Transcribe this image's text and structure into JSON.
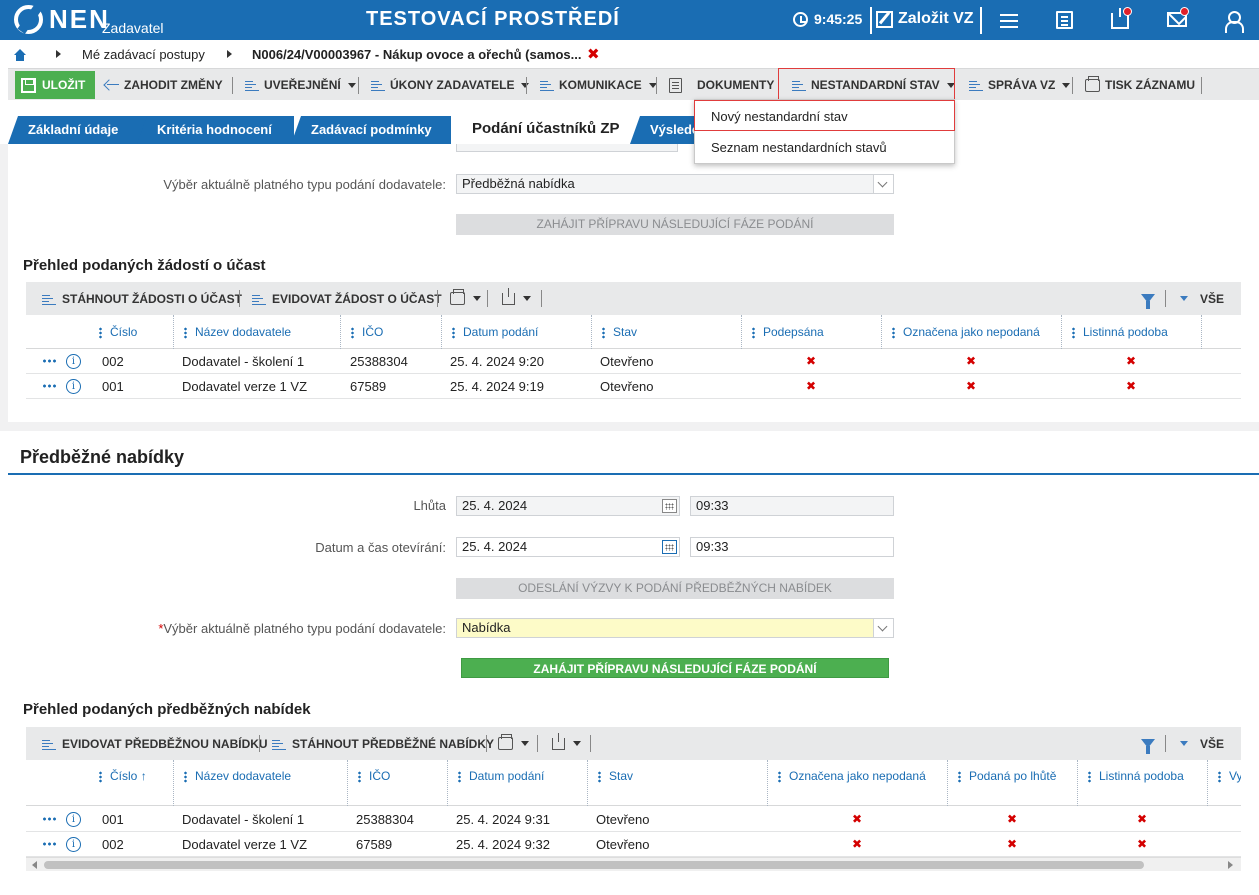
{
  "topbar": {
    "logo_text": "NEN",
    "logo_sub": "Zadavatel",
    "env_title": "TESTOVACÍ PROSTŘEDÍ",
    "time": "9:45:25",
    "create_label": "Založit VZ",
    "icons": [
      "clock-icon",
      "edit-icon",
      "menu-icon",
      "calculator-icon",
      "inbox-icon",
      "mail-icon",
      "user-icon"
    ],
    "accent": "#1a6db3"
  },
  "breadcrumb": {
    "items": [
      "Mé zadávací postupy",
      "N006/24/V00003967 - Nákup ovoce a ořechů (samos..."
    ],
    "close": "✖"
  },
  "toolbar": {
    "save": "ULOŽIT",
    "discard": "ZAHODIT ZMĚNY",
    "publish": "UVEŘEJNĚNÍ",
    "actions": "ÚKONY ZADAVATELE",
    "communication": "KOMUNIKACE",
    "documents": "DOKUMENTY",
    "nonstandard": "NESTANDARDNÍ STAV",
    "manage": "SPRÁVA VZ",
    "print": "TISK ZÁZNAMU"
  },
  "dropdown": {
    "items": [
      "Nový nestandardní stav",
      "Seznam nestandardních stavů"
    ]
  },
  "tabs": [
    "Základní údaje",
    "Kritéria hodnocení",
    "Zadávací podmínky",
    "Podání účastníků ZP",
    "Výsledek"
  ],
  "section1": {
    "type_label": "Výběr aktuálně platného typu podání dodavatele:",
    "type_value": "Předběžná nabídka",
    "next_phase": "ZAHÁJIT PŘÍPRAVU NÁSLEDUJÍCÍ FÁZE PODÁNÍ",
    "grid_title": "Přehled podaných žádostí o účast",
    "btn_download": "STÁHNOUT ŽÁDOSTI O ÚČAST",
    "btn_register": "EVIDOVAT ŽÁDOST O ÚČAST",
    "all": "VŠE",
    "columns": [
      "Číslo",
      "Název dodavatele",
      "IČO",
      "Datum podání",
      "Stav",
      "Podepsána",
      "Označena jako nepodaná",
      "Listinná podoba"
    ],
    "rows": [
      {
        "cislo": "002",
        "nazev": "Dodavatel - školení 1",
        "ico": "25388304",
        "datum": "25. 4. 2024 9:20",
        "stav": "Otevřeno",
        "c1": "✖",
        "c2": "✖",
        "c3": "✖"
      },
      {
        "cislo": "001",
        "nazev": "Dodavatel verze 1 VZ",
        "ico": "67589",
        "datum": "25. 4. 2024 9:19",
        "stav": "Otevřeno",
        "c1": "✖",
        "c2": "✖",
        "c3": "✖"
      }
    ]
  },
  "section2": {
    "title": "Předběžné nabídky",
    "lhuta_label": "Lhůta",
    "lhuta_date": "25. 4. 2024",
    "lhuta_time": "09:33",
    "open_label": "Datum a čas otevírání:",
    "open_date": "25. 4. 2024",
    "open_time": "09:33",
    "send_call": "ODESLÁNÍ VÝZVY K PODÁNÍ PŘEDBĚŽNÝCH NABÍDEK",
    "required_mark": "*",
    "type_label": "Výběr aktuálně platného typu podání dodavatele:",
    "type_value": "Nabídka",
    "next_phase": "ZAHÁJIT PŘÍPRAVU NÁSLEDUJÍCÍ FÁZE PODÁNÍ",
    "grid_title": "Přehled podaných předběžných nabídek",
    "btn_register": "EVIDOVAT PŘEDBĚŽNOU NABÍDKU",
    "btn_download": "STÁHNOUT PŘEDBĚŽNÉ NABÍDKY",
    "all": "VŠE",
    "columns": [
      "Číslo",
      "Název dodavatele",
      "IČO",
      "Datum podání",
      "Stav",
      "Označena jako nepodaná",
      "Podaná po lhůtě",
      "Listinná podoba",
      "Vy sl"
    ],
    "sort_arrow": "↑",
    "rows": [
      {
        "cislo": "001",
        "nazev": "Dodavatel - školení 1",
        "ico": "25388304",
        "datum": "25. 4. 2024 9:31",
        "stav": "Otevřeno",
        "c1": "✖",
        "c2": "✖",
        "c3": "✖"
      },
      {
        "cislo": "002",
        "nazev": "Dodavatel verze 1 VZ",
        "ico": "67589",
        "datum": "25. 4. 2024 9:32",
        "stav": "Otevřeno",
        "c1": "✖",
        "c2": "✖",
        "c3": "✖"
      }
    ]
  }
}
